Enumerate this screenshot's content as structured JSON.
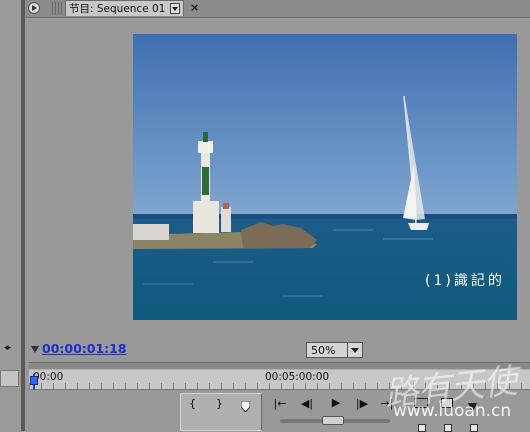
{
  "tab": {
    "title": "节目: Sequence 01",
    "close_glyph": "×"
  },
  "monitor": {
    "subtitle": "(1)識記的",
    "timecode": "00:00:01:18",
    "zoom": "50%"
  },
  "timeline_ruler": {
    "start_label": "00:00",
    "mid_label": "00:05:00:00"
  },
  "transport": {
    "mark_in": "{",
    "mark_out": "}",
    "go_to_in": "|←",
    "step_back": "◀|",
    "play": "▶",
    "step_forward": "|▶",
    "go_to_out": "→|"
  },
  "side_arrows": "◂▸",
  "watermark": {
    "logo_text": "路有天使",
    "url": "www.luoan.cn"
  },
  "colors": {
    "timecode": "#1d2fc8",
    "playhead": "#1b3fd6",
    "panel_bg": "#999999"
  },
  "icons": [
    "panel-menu-icon",
    "tab-dropdown-icon",
    "close-icon",
    "set-marker-icon",
    "lift-icon",
    "extract-icon",
    "export-frame-icon"
  ]
}
